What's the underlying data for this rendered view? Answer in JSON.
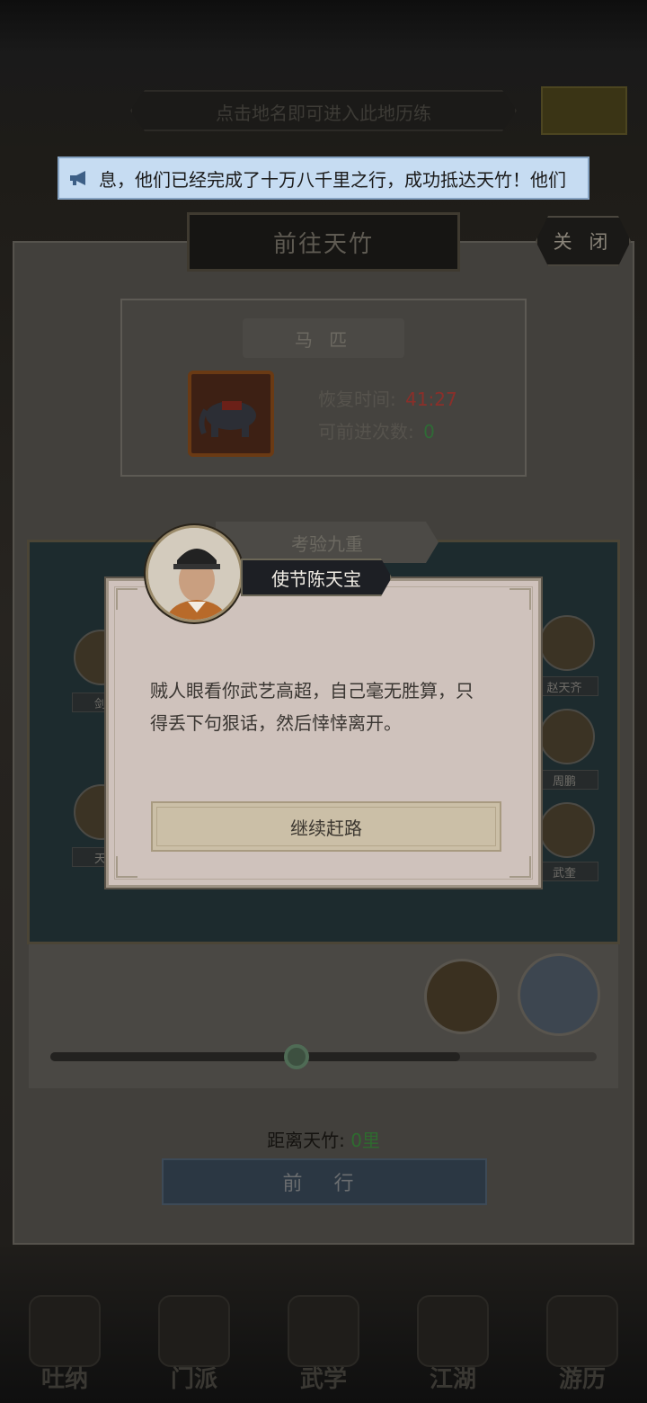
{
  "location_bar": {
    "text": "点击地名即可进入此地历练"
  },
  "broadcast": {
    "icon": "megaphone-icon",
    "text": "息，他们已经完成了十万八千里之行，成功抵达天竹！他们"
  },
  "panel": {
    "title": "前往天竹",
    "close_label": "关 闭",
    "horse": {
      "label": "马 匹",
      "recovery_label": "恢复时间:",
      "recovery_value": "41:27",
      "advances_label": "可前进次数:",
      "advances_value": "0"
    },
    "stage": {
      "label": "考验九重",
      "left_npcs": [
        "剑浮",
        "天竺"
      ],
      "right_npcs": [
        "赵天齐",
        "周鹏",
        "武奎"
      ]
    },
    "progress": 0.75,
    "distance_label": "距离天竹:",
    "distance_value": "0里",
    "go_label": "前 行"
  },
  "dialog": {
    "speaker": "使节陈天宝",
    "message_line1": "贼人眼看你武艺高超，自己毫无胜算，只",
    "message_line2": "得丢下句狠话，然后悻悻离开。",
    "continue_label": "继续赶路"
  },
  "nav": [
    {
      "label": "吐纳"
    },
    {
      "label": "门派"
    },
    {
      "label": "武学"
    },
    {
      "label": "江湖"
    },
    {
      "label": "游历"
    }
  ],
  "colors": {
    "recovery": "#8a2f2a",
    "advances": "#2f6a36",
    "distance_value": "#2e6b2f",
    "broadcast_bg": "#c6dcf2",
    "modal_bg": "#cfc2bc"
  }
}
